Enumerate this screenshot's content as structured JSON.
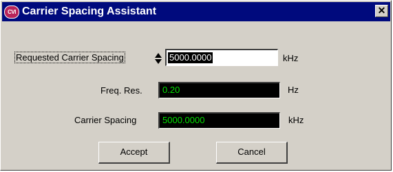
{
  "window": {
    "title": "Carrier Spacing Assistant",
    "icon": "cvi-logo",
    "icon_text": "CVI",
    "close_symbol": "✕"
  },
  "requested": {
    "label": "Requested Carrier Spacing",
    "value": "5000.0000",
    "unit": "kHz"
  },
  "freq_res": {
    "label": "Freq. Res.",
    "value": "0.20",
    "unit": "Hz"
  },
  "carrier_spacing": {
    "label": "Carrier Spacing",
    "value": "5000.0000",
    "unit": "kHz"
  },
  "buttons": {
    "accept": "Accept",
    "cancel": "Cancel"
  },
  "colors": {
    "titlebar": "#000a7d",
    "dialog_bg": "#d4d0c8",
    "readout_bg": "#000000",
    "readout_text": "#00e000"
  }
}
